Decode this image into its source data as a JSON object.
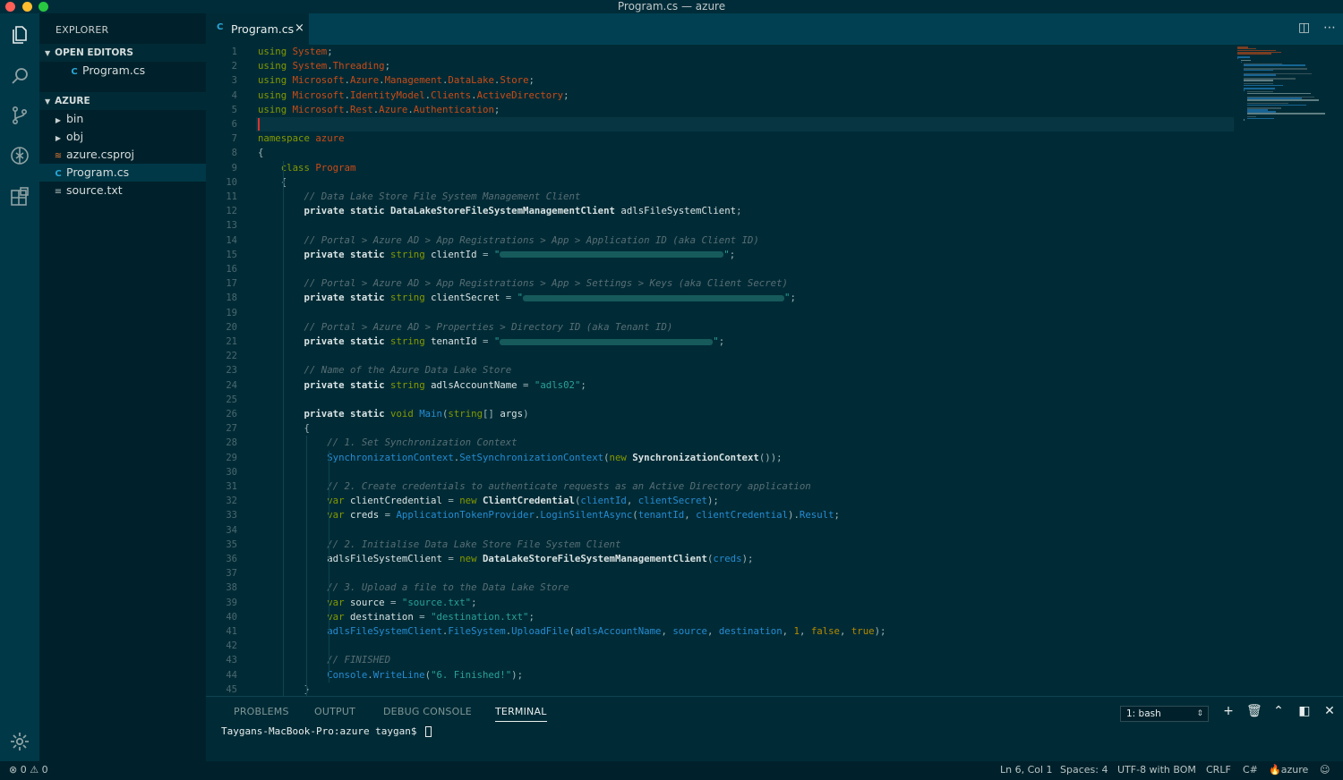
{
  "window": {
    "title": "Program.cs — azure"
  },
  "activity_bar": {
    "icons": [
      "files-icon",
      "search-icon",
      "source-control-icon",
      "debug-icon",
      "extensions-icon",
      "gear-icon"
    ]
  },
  "sidebar": {
    "title": "EXPLORER",
    "open_editors_label": "OPEN EDITORS",
    "open_editors": [
      {
        "label": "Program.cs",
        "icon": "csharp-file-icon"
      }
    ],
    "folder_label": "AZURE",
    "tree": [
      {
        "label": "bin",
        "icon": "chevron-right-icon"
      },
      {
        "label": "obj",
        "icon": "chevron-right-icon"
      },
      {
        "label": "azure.csproj",
        "icon": "rss-file-icon"
      },
      {
        "label": "Program.cs",
        "icon": "csharp-file-icon",
        "selected": true
      },
      {
        "label": "source.txt",
        "icon": "text-file-icon"
      }
    ]
  },
  "editor": {
    "tab": {
      "label": "Program.cs",
      "close": "×"
    },
    "line_numbers": [
      "1",
      "2",
      "3",
      "4",
      "5",
      "6",
      "7",
      "8",
      "9",
      "10",
      "11",
      "12",
      "13",
      "14",
      "15",
      "16",
      "17",
      "18",
      "19",
      "20",
      "21",
      "22",
      "23",
      "24",
      "25",
      "26",
      "27",
      "28",
      "29",
      "30",
      "31",
      "32",
      "33",
      "34",
      "35",
      "36",
      "37",
      "38",
      "39",
      "40",
      "41",
      "42",
      "43",
      "44",
      "45"
    ],
    "code": [
      "using System;",
      "using System.Threading;",
      "using Microsoft.Azure.Management.DataLake.Store;",
      "using Microsoft.IdentityModel.Clients.ActiveDirectory;",
      "using Microsoft.Rest.Azure.Authentication;",
      "",
      "namespace azure",
      "{",
      "    class Program",
      "    {",
      "        // Data Lake Store File System Management Client",
      "        private static DataLakeStoreFileSystemManagementClient adlsFileSystemClient;",
      "",
      "        // Portal > Azure AD > App Registrations > App > Application ID (aka Client ID)",
      "        private static string clientId = \"\";",
      "",
      "        // Portal > Azure AD > App Registrations > App > Settings > Keys (aka Client Secret)",
      "        private static string clientSecret = \"\";",
      "",
      "        // Portal > Azure AD > Properties > Directory ID (aka Tenant ID)",
      "        private static string tenantId = \"\";",
      "",
      "        // Name of the Azure Data Lake Store",
      "        private static string adlsAccountName = \"adls02\";",
      "",
      "        private static void Main(string[] args)",
      "        {",
      "            // 1. Set Synchronization Context",
      "            SynchronizationContext.SetSynchronizationContext(new SynchronizationContext());",
      "",
      "            // 2. Create credentials to authenticate requests as an Active Directory application",
      "            var clientCredential = new ClientCredential(clientId, clientSecret);",
      "            var creds = ApplicationTokenProvider.LoginSilentAsync(tenantId, clientCredential).Result;",
      "",
      "            // 2. Initialise Data Lake Store File System Client",
      "            adlsFileSystemClient = new DataLakeStoreFileSystemManagementClient(creds);",
      "",
      "            // 3. Upload a file to the Data Lake Store",
      "            var source = \"source.txt\";",
      "            var destination = \"destination.txt\";",
      "            adlsFileSystemClient.FileSystem.UploadFile(adlsAccountName, source, destination, 1, false, true);",
      "",
      "            // FINISHED",
      "            Console.WriteLine(\"6. Finished!\");",
      "        }"
    ]
  },
  "panel": {
    "tabs": [
      "PROBLEMS",
      "OUTPUT",
      "DEBUG CONSOLE",
      "TERMINAL"
    ],
    "active_tab": "TERMINAL",
    "terminal_select": "1: bash",
    "terminal_prompt": "Taygans-MacBook-Pro:azure taygan$ "
  },
  "status_bar": {
    "errors": "0",
    "warnings": "0",
    "position": "Ln 6, Col 1",
    "spaces": "Spaces: 4",
    "encoding": "UTF-8 with BOM",
    "eol": "CRLF",
    "language": "C#",
    "project": "azure"
  },
  "colors": {
    "background": "#002b36",
    "keyword": "#859900",
    "namespace": "#cb4b16",
    "string": "#2aa198",
    "function": "#268bd2",
    "comment": "#586e75",
    "constant": "#b58900"
  }
}
